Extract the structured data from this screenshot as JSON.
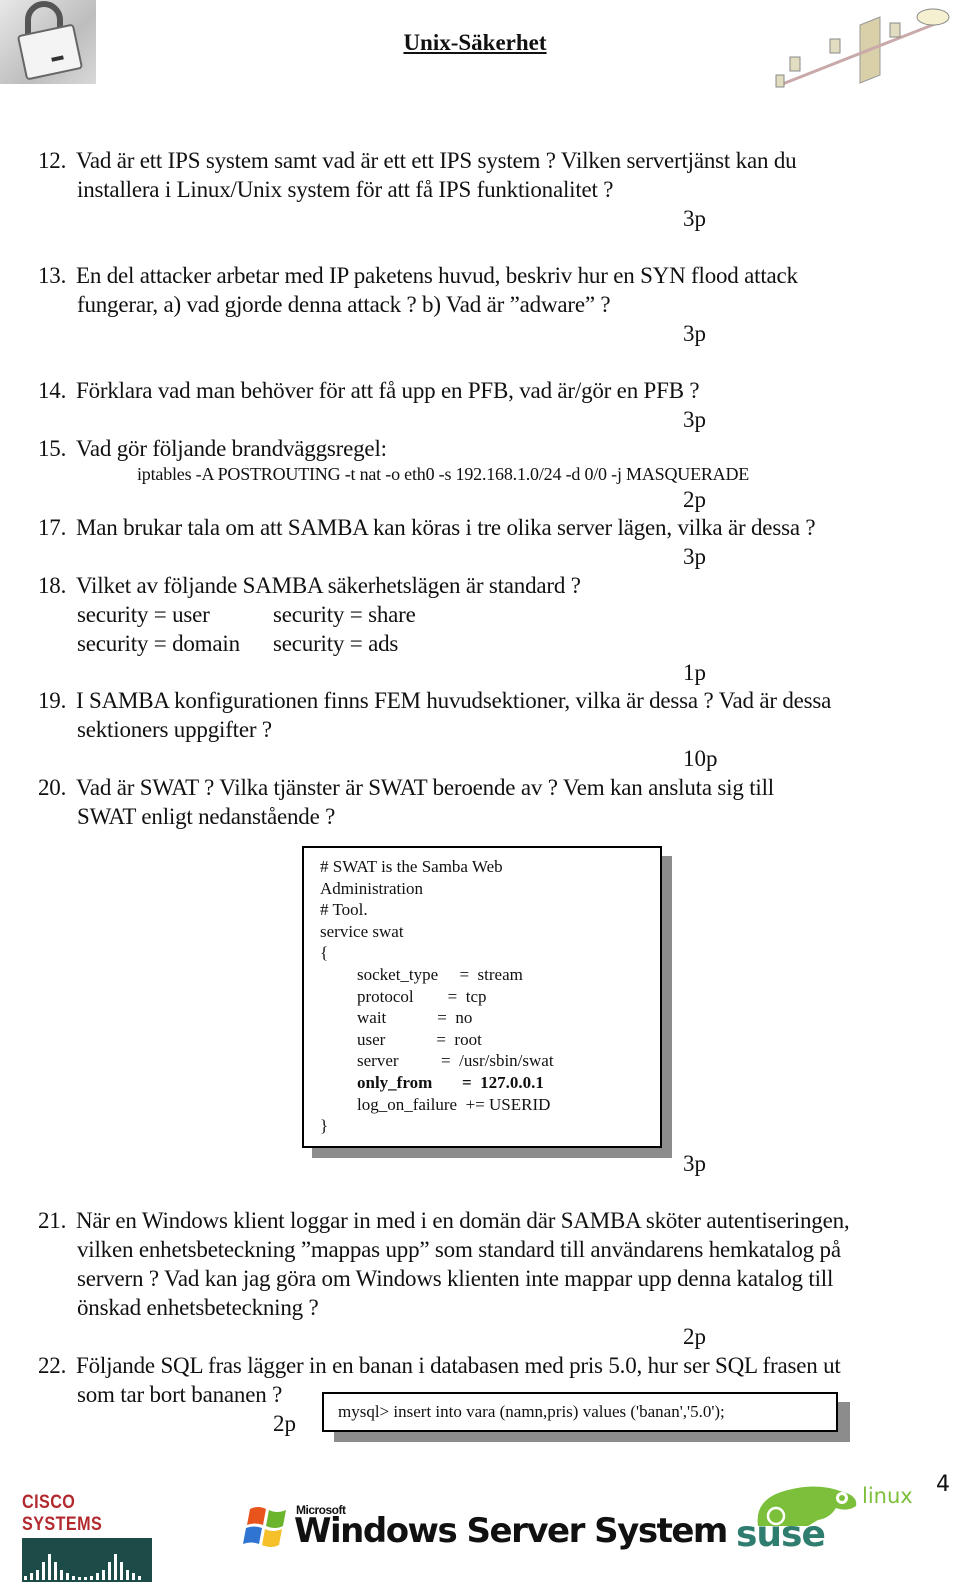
{
  "header": {
    "title": "Unix-Säkerhet",
    "left_image": "padlock-image",
    "right_image": "network-diagram-image"
  },
  "questions": [
    {
      "num": "12.",
      "lines": [
        "Vad är ett IPS system samt vad är ett ett IPS system ? Vilken servertjänst kan du",
        "installera i Linux/Unix system för att få IPS funktionalitet ?"
      ],
      "points": "3p"
    },
    {
      "num": "13.",
      "lines": [
        "En del attacker arbetar med IP paketens huvud, beskriv hur en SYN flood attack",
        "fungerar, a) vad gjorde denna attack ? b) Vad är ”adware” ?"
      ],
      "points": "3p"
    },
    {
      "num": "14.",
      "lines": [
        "Förklara vad man behöver för att få upp en PFB, vad är/gör en PFB ?"
      ],
      "points": "3p"
    },
    {
      "num": "15.",
      "lines": [
        "Vad gör följande brandväggsregel:"
      ],
      "command": "iptables -A POSTROUTING -t nat -o eth0 -s 192.168.1.0/24 -d 0/0 -j MASQUERADE",
      "points": "2p"
    },
    {
      "num": "17.",
      "lines": [
        "Man brukar tala om att SAMBA kan köras i tre olika server lägen, vilka är dessa ?"
      ],
      "points": "3p"
    },
    {
      "num": "18.",
      "lines": [
        "Vilket av följande SAMBA säkerhetslägen är standard ?"
      ],
      "options": [
        "security = user",
        "security = share",
        "security = domain",
        "security = ads"
      ],
      "points": "1p"
    },
    {
      "num": "19.",
      "lines": [
        "I SAMBA konfigurationen finns FEM huvudsektioner, vilka är dessa ? Vad är dessa",
        "sektioners uppgifter ?"
      ],
      "points": "10p"
    },
    {
      "num": "20.",
      "lines": [
        "Vad är SWAT ? Vilka tjänster är SWAT beroende av ? Vem kan ansluta sig till",
        "SWAT enligt nedanstående ?"
      ],
      "points": "3p"
    },
    {
      "num": "21.",
      "lines": [
        "När en Windows klient loggar in med i en domän där SAMBA sköter autentiseringen,",
        "vilken enhetsbeteckning ”mappas upp” som standard till användarens hemkatalog på",
        "servern ? Vad kan jag göra om Windows klienten inte mappar upp denna katalog till",
        "önskad enhetsbeteckning ?"
      ],
      "points": "2p"
    },
    {
      "num": "22.",
      "lines": [
        "Följande SQL fras lägger in en banan i databasen med pris 5.0, hur ser SQL frasen ut",
        "som tar bort bananen ?"
      ],
      "points": "2p"
    }
  ],
  "swat_config": [
    "# SWAT is the Samba Web",
    "Administration",
    "# Tool.",
    "service swat",
    "{",
    "socket_type     =  stream",
    "protocol        =  tcp",
    "wait            =  no",
    "user            =  root",
    "server          =  /usr/sbin/swat",
    "only_from       =  127.0.0.1",
    "log_on_failure  += USERID",
    "}"
  ],
  "sql_statement": "mysql> insert into vara (namn,pris) values ('banan','5.0');",
  "footer": {
    "logos": [
      "Cisco Systems",
      "Microsoft Windows Server System",
      "SuSE linux"
    ],
    "cisco_text": "CISCO SYSTEMS",
    "ms_small": "Microsoft",
    "ms_big": "Windows Server System",
    "suse_text": "suse",
    "linux_text": "linux",
    "page_number": "4"
  },
  "colors": {
    "cisco_red": "#b22a2e",
    "cisco_bar": "#1d4b47",
    "suse_green": "#7bbf3a",
    "suse_dark": "#2e7d6e",
    "shadow": "#8c8c8c"
  }
}
